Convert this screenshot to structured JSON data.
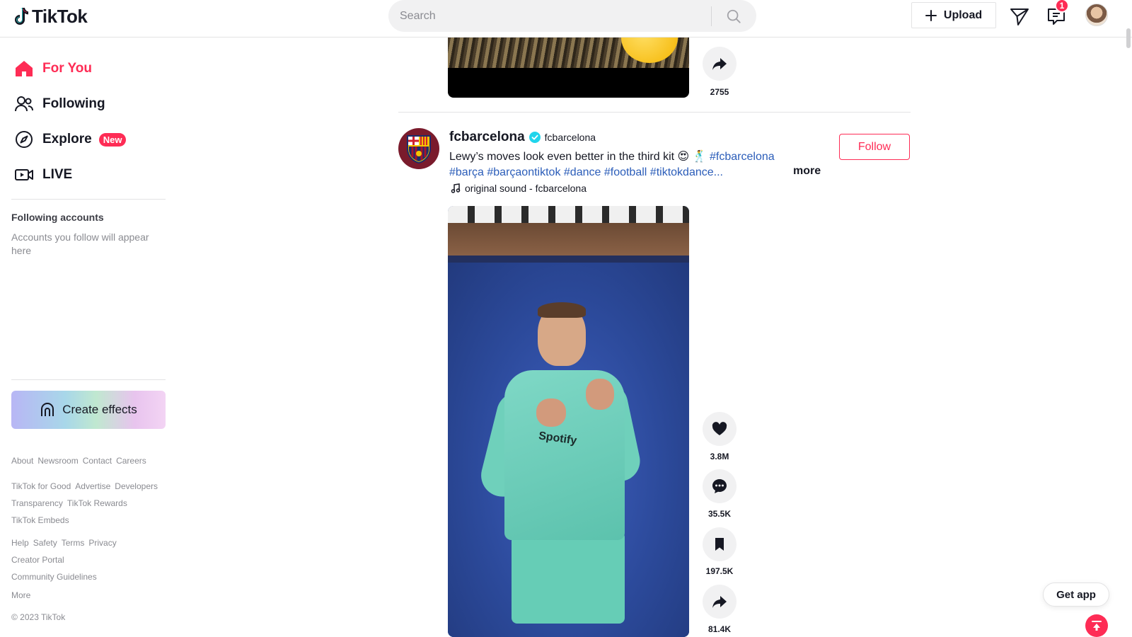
{
  "app": {
    "logo_text": "TikTok"
  },
  "header": {
    "search_placeholder": "Search",
    "upload_label": "Upload",
    "inbox_badge": "1"
  },
  "sidebar": {
    "nav": [
      {
        "label": "For You",
        "icon": "home-icon",
        "active": true
      },
      {
        "label": "Following",
        "icon": "users-icon"
      },
      {
        "label": "Explore",
        "icon": "compass-icon",
        "badge": "New"
      },
      {
        "label": "LIVE",
        "icon": "live-camera-icon"
      }
    ],
    "following_title": "Following accounts",
    "following_empty": "Accounts you follow will appear here",
    "create_effects": "Create effects",
    "footer_groups": [
      [
        "About",
        "Newsroom",
        "Contact",
        "Careers"
      ],
      [
        "TikTok for Good",
        "Advertise",
        "Developers",
        "Transparency",
        "TikTok Rewards",
        "TikTok Embeds"
      ],
      [
        "Help",
        "Safety",
        "Terms",
        "Privacy",
        "Creator Portal",
        "Community Guidelines"
      ],
      [
        "More"
      ]
    ],
    "copyright": "© 2023 TikTok"
  },
  "prev_post": {
    "share_count": "2755"
  },
  "post": {
    "username": "fcbarcelona",
    "nickname": "fcbarcelona",
    "follow_label": "Follow",
    "caption_text": "Lewy’s moves look even better in the third kit 😍 🕺",
    "hashtags": [
      "#fcbarcelona",
      "#barça",
      "#barçaontiktok",
      "#dance",
      "#football",
      "#tiktokdance..."
    ],
    "more_label": "more",
    "sound": "original sound - fcbarcelona",
    "video_sponsor": "Spotify",
    "likes": "3.8M",
    "comments": "35.5K",
    "saves": "197.5K",
    "shares": "81.4K"
  },
  "floating": {
    "get_app": "Get app"
  },
  "colors": {
    "brand": "#fe2c55",
    "hashtag": "#2b5db9",
    "text": "#161823",
    "muted": "#8a8b91"
  }
}
